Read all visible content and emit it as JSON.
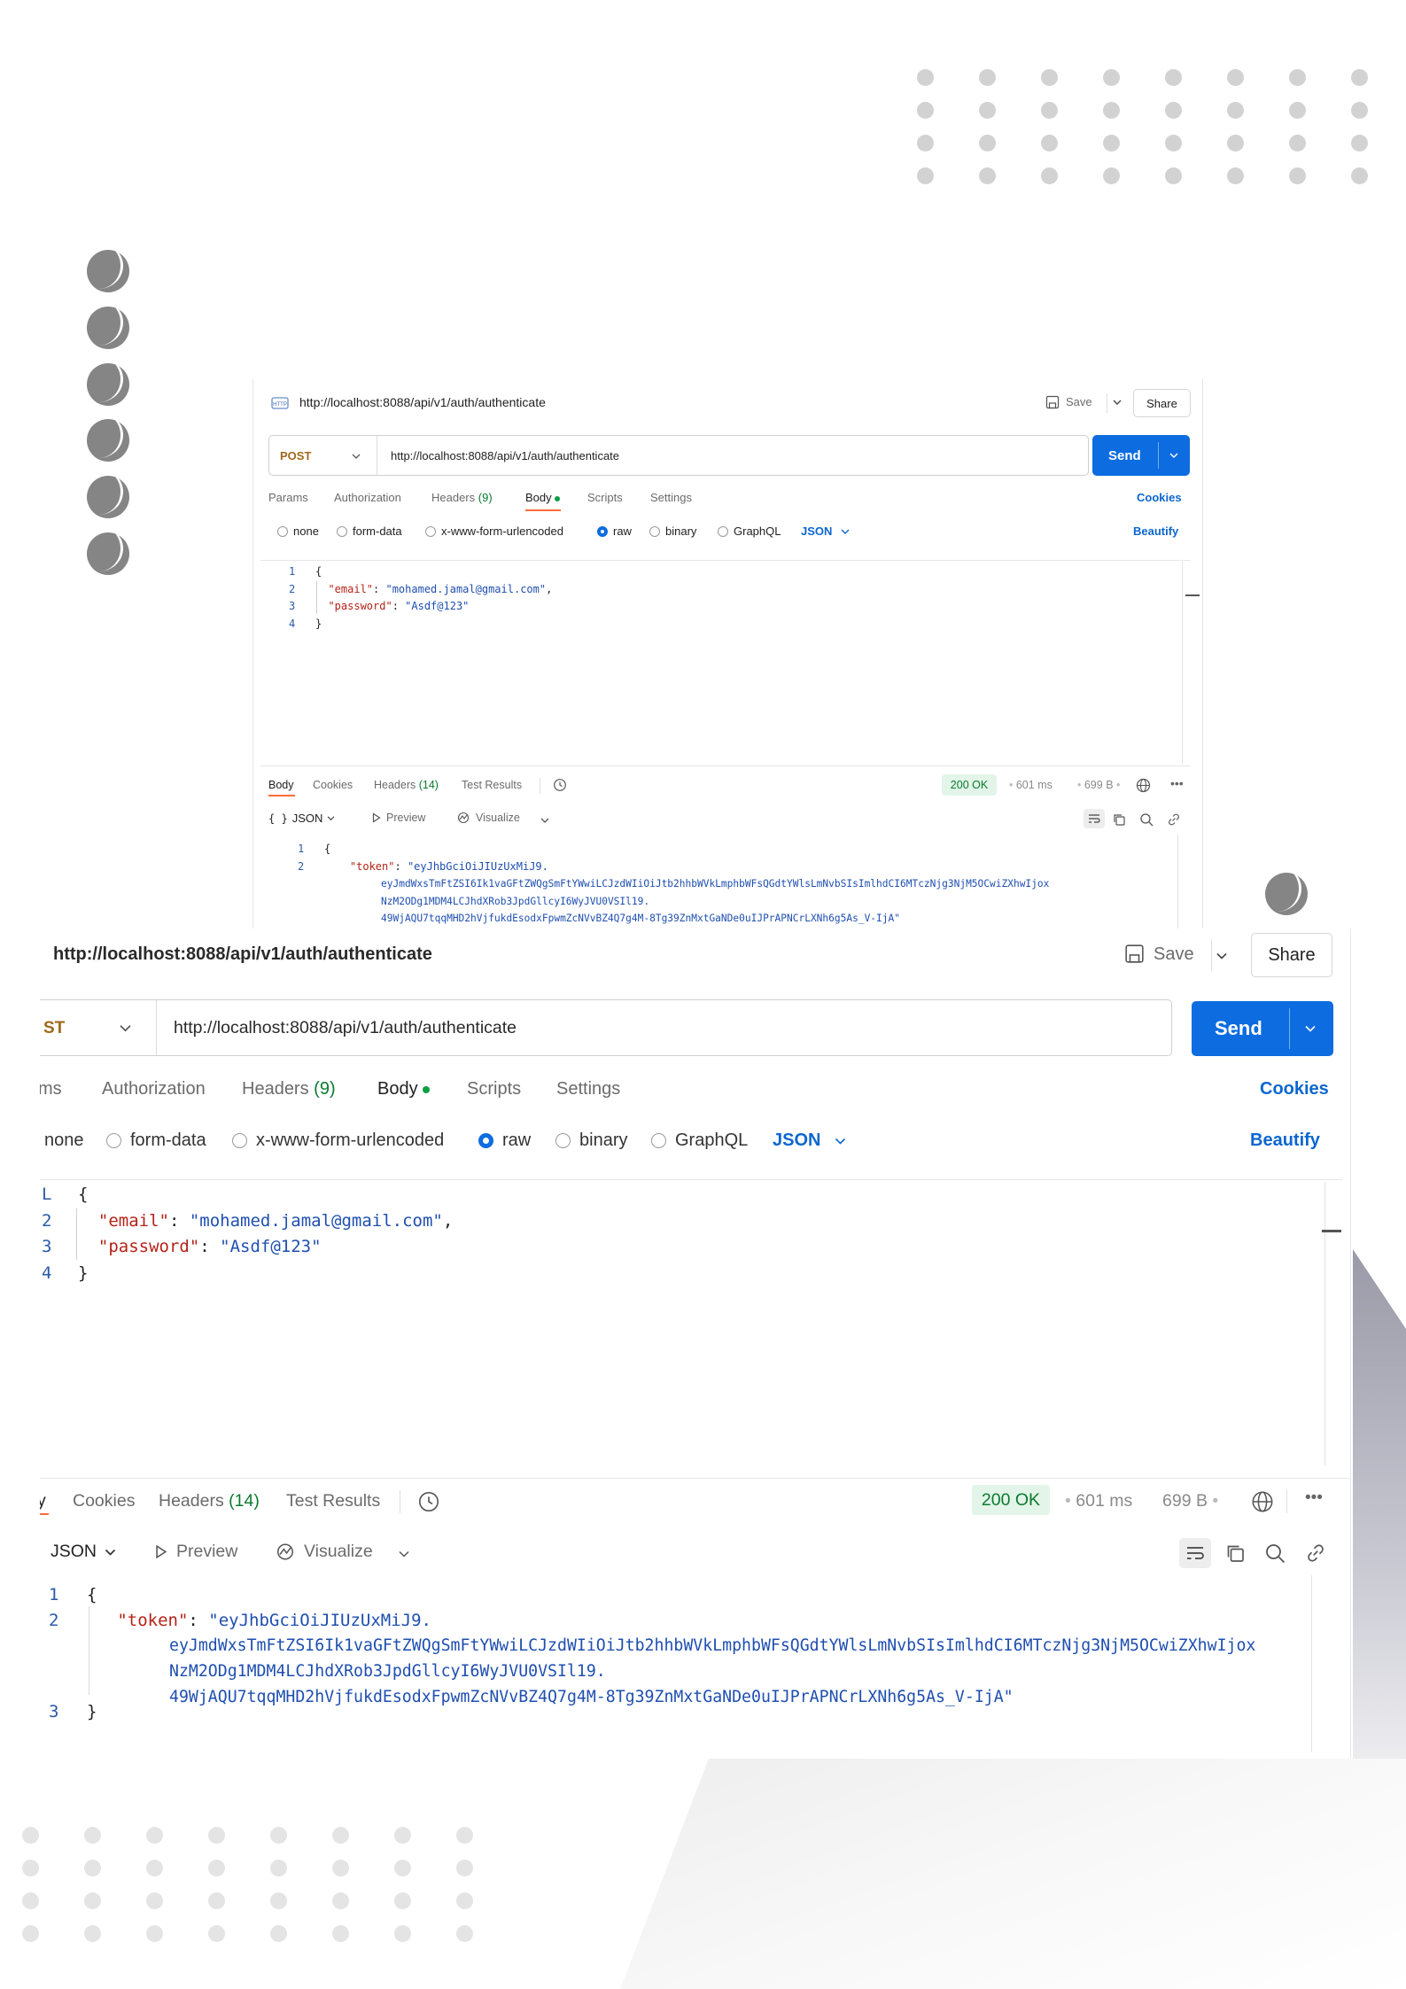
{
  "request": {
    "title": "http://localhost:8088/api/v1/auth/authenticate",
    "save_label": "Save",
    "share_label": "Share",
    "method_small": "POST",
    "method_large": "ST",
    "url": "http://localhost:8088/api/v1/auth/authenticate",
    "send_label": "Send",
    "tabs_small": [
      "Params",
      "Authorization",
      "Headers",
      "Body",
      "Scripts",
      "Settings"
    ],
    "tabs_large_first": "ms",
    "headers_count": "(9)",
    "cookies_label": "Cookies",
    "body_types": [
      "none",
      "form-data",
      "x-www-form-urlencoded",
      "raw",
      "binary",
      "GraphQL"
    ],
    "body_type_selected": "raw",
    "format": "JSON",
    "beautify_label": "Beautify",
    "body_lines": [
      {
        "num": "1",
        "text": "{"
      },
      {
        "num": "2",
        "key": "\"email\"",
        "sep": ": ",
        "value": "\"mohamed.jamal@gmail.com\"",
        "tail": ","
      },
      {
        "num": "3",
        "key": "\"password\"",
        "sep": ": ",
        "value": "\"Asdf@123\"",
        "tail": ""
      },
      {
        "num": "4",
        "text": "}"
      }
    ],
    "body_nums_large": [
      "L",
      "2",
      "3",
      "4"
    ]
  },
  "response": {
    "tabs": [
      "Body",
      "Cookies",
      "Headers",
      "Test Results"
    ],
    "tab_first_large": "y",
    "headers_count": "(14)",
    "status": "200 OK",
    "time": "601 ms",
    "size": "699 B",
    "view_format": "JSON",
    "preview_label": "Preview",
    "visualize_label": "Visualize",
    "token_key": "\"token\"",
    "token_lines": [
      "\"eyJhbGciOiJIUzUxMiJ9.",
      "eyJmdWxsTmFtZSI6Ik1vaGFtZWQgSmFtYWwiLCJzdWIiOiJtb2hhbWVkLmphbWFsQGdtYWlsLmNvbSIsImlhdCI6MTczNjg3NjM5OCwiZXhwIjox",
      "NzM2ODg1MDM4LCJhdXRob3JpdGllcyI6WyJVU0VSIl19.",
      "49WjAQU7tqqMHD2hVjfukdEsodxFpwmZcNVvBZ4Q7g4M-8Tg39ZnMxtGaNDe0uIJPrAPNCrLXNh6g5As_V-IjA\""
    ],
    "line_nums": [
      "1",
      "2",
      "3"
    ],
    "open_brace": "{",
    "close_brace": "}"
  },
  "colors": {
    "accent": "#0c6ce0",
    "method": "#a0681a",
    "status_green": "#0a7a2f"
  }
}
